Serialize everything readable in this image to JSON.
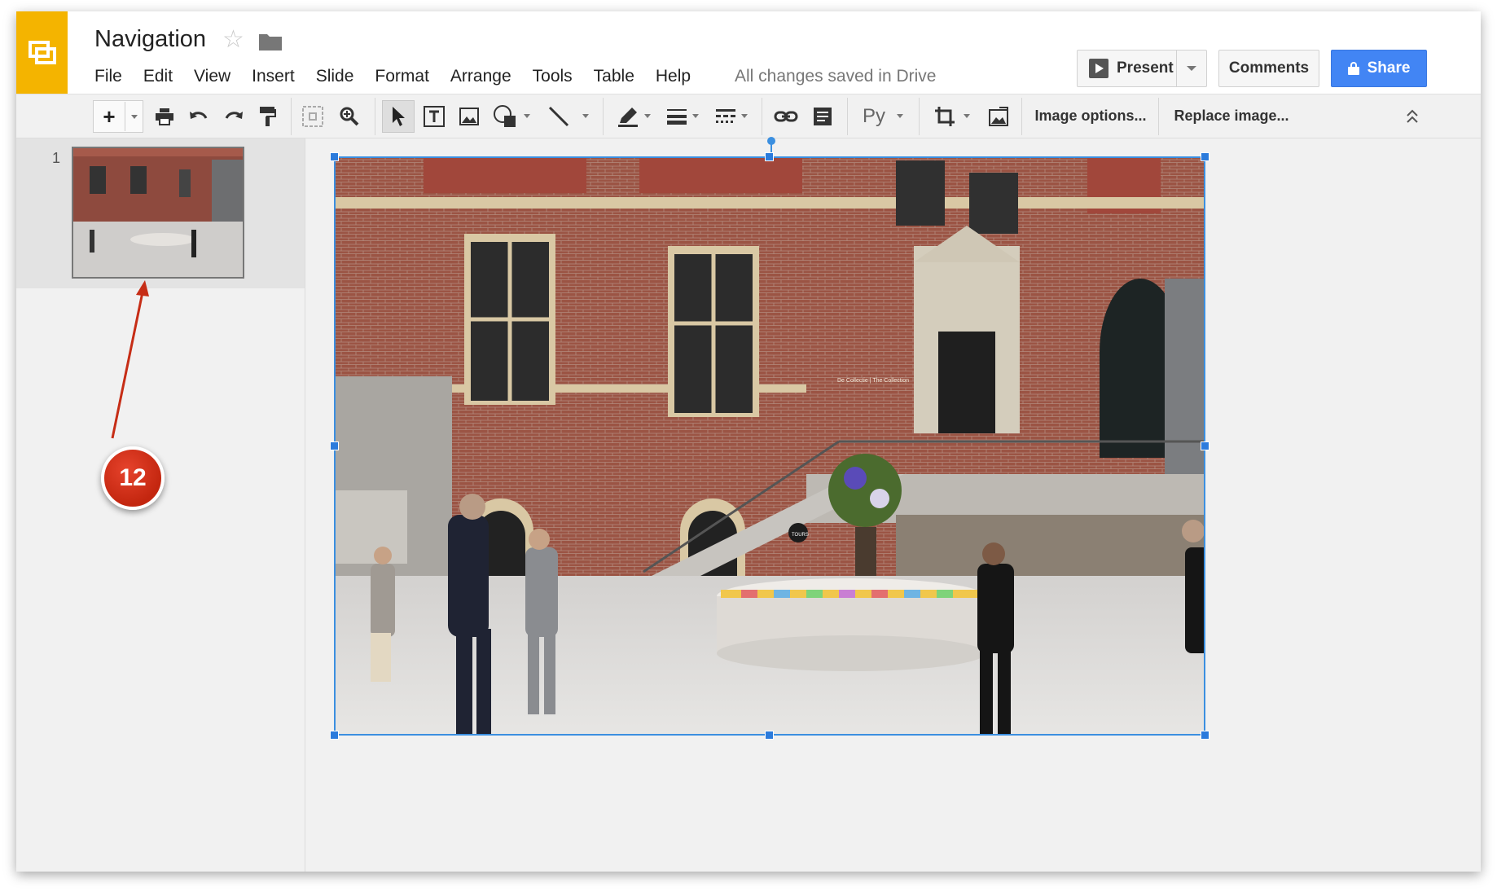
{
  "app": {
    "title": "Navigation",
    "save_status": "All changes saved in Drive"
  },
  "menu": [
    "File",
    "Edit",
    "View",
    "Insert",
    "Slide",
    "Format",
    "Arrange",
    "Tools",
    "Table",
    "Help"
  ],
  "header_buttons": {
    "present": "Present",
    "comments": "Comments",
    "share": "Share"
  },
  "toolbar": {
    "add": "+",
    "image_options": "Image options...",
    "replace_image": "Replace image...",
    "input_tools": "Py"
  },
  "filmstrip": {
    "slides": [
      {
        "number": "1"
      }
    ]
  },
  "callout": {
    "number": "12"
  },
  "image": {
    "caption_text": "De Collectie | The Collection",
    "sign_text": "TOURS"
  },
  "colors": {
    "logo": "#f4b400",
    "share": "#4285f4",
    "selection": "#3b8fe0",
    "callout": "#d0341a"
  }
}
